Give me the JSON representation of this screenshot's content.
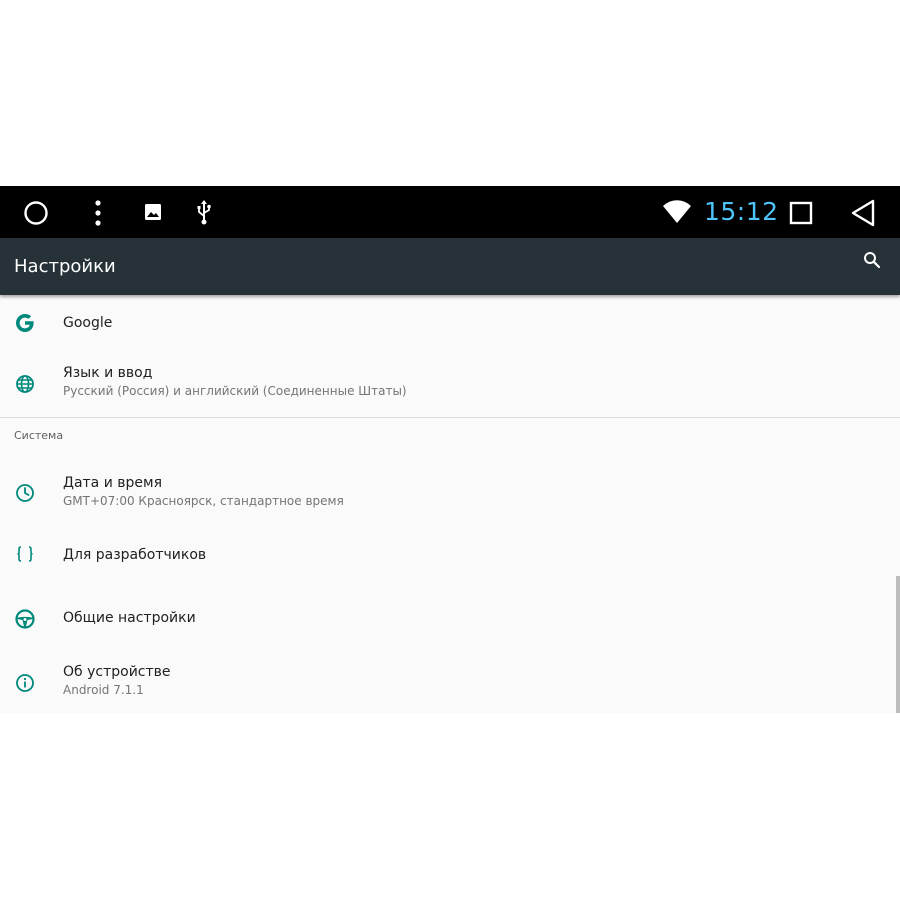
{
  "status_bar": {
    "clock": "15:12",
    "clock_color": "#4fc3f7",
    "icons": [
      "home-circle-icon",
      "overflow-menu-icon",
      "image-icon",
      "usb-icon",
      "wifi-icon",
      "recents-square-icon",
      "back-triangle-icon"
    ]
  },
  "app_bar": {
    "title": "Настройки",
    "background": "#263238",
    "search_icon": "search-icon"
  },
  "accent_color": "#00897b",
  "sections": {
    "top_items": [
      {
        "icon": "google-icon",
        "title": "Google",
        "summary": ""
      },
      {
        "icon": "globe-icon",
        "title": "Язык и ввод",
        "summary": "Русский (Россия) и английский (Соединенные Штаты)"
      }
    ],
    "system": {
      "header": "Система",
      "items": [
        {
          "icon": "clock-icon",
          "title": "Дата и время",
          "summary": "GMT+07:00 Красноярск, стандартное время"
        },
        {
          "icon": "developer-braces-icon",
          "title": "Для разработчиков",
          "summary": ""
        },
        {
          "icon": "steering-wheel-icon",
          "title": "Общие настройки",
          "summary": ""
        },
        {
          "icon": "info-icon",
          "title": "Об устройстве",
          "summary": "Android 7.1.1"
        }
      ]
    }
  }
}
